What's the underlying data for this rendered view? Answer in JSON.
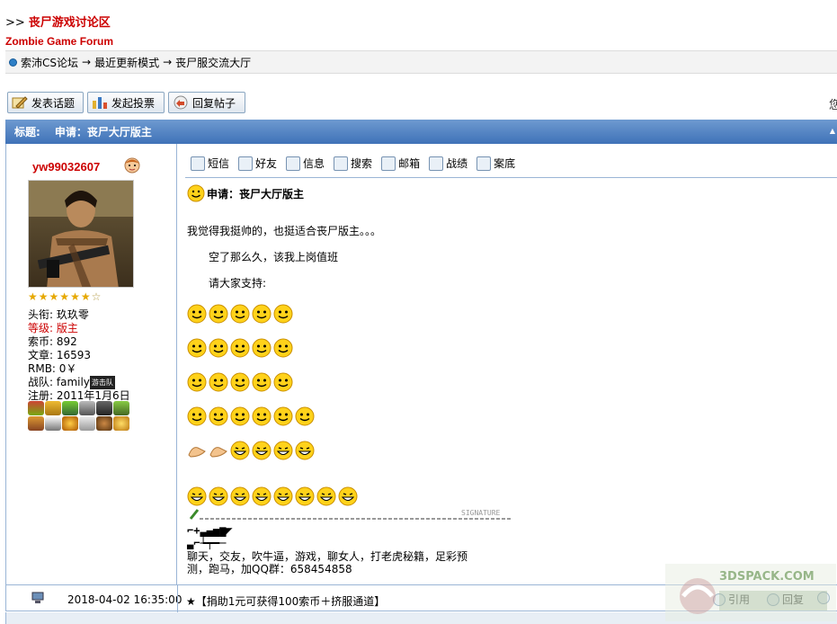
{
  "forum": {
    "arrows": ">>",
    "title_cn": "丧尸游戏讨论区",
    "title_en": "Zombie Game Forum"
  },
  "breadcrumb": {
    "items": [
      "索沛CS论坛",
      "最近更新模式",
      "丧尸服交流大厅"
    ],
    "separator": "→"
  },
  "toolbar": {
    "new_topic": "发表话题",
    "new_poll": "发起投票",
    "reply": "回复帖子",
    "edge_char": "您"
  },
  "topic": {
    "label": "标题:",
    "title": "申请：丧尸大厅版主"
  },
  "user": {
    "name": "yw99032607",
    "stars_filled": 6,
    "stars_total": 7,
    "rank_label": "头衔:",
    "rank": "玖玖零",
    "level_label": "等级:",
    "level": "版主",
    "coins_label": "索币:",
    "coins": "892",
    "posts_label": "文章:",
    "posts": "16593",
    "rmb_label": "RMB:",
    "rmb": "0￥",
    "team_label": "战队:",
    "team": "family",
    "team_badge": "游击队",
    "reg_label": "注册:",
    "reg": "2011年1月6日"
  },
  "actions": [
    "短信",
    "好友",
    "信息",
    "搜索",
    "邮箱",
    "战绩",
    "案底"
  ],
  "post": {
    "title": "申请：丧尸大厅版主",
    "line1": "我觉得我挺帅的，也挺适合丧尸版主。。。",
    "line2": "空了那么久，该我上岗值班",
    "line3": "请大家支持:",
    "signature_label": "SIGNATURE",
    "sig_art1": "⌐+▃▄▅▆◤",
    "sig_art2": "▃⌐┶┯━─",
    "sig_text": "聊天，交友，吹牛逼，游戏，聊女人，打老虎秘籍，足彩预测，跑马，加QQ群：658454858"
  },
  "footer": {
    "date": "2018-04-02 16:35:00",
    "notice": "★【捐助1元可获得100索币＋挤服通道】",
    "quote": "引用",
    "reply": "回复"
  },
  "watermark": {
    "text": "3DSPACK.COM"
  },
  "colors": {
    "accent_red": "#cc0000",
    "header_blue": "#4a7bbf",
    "border_blue": "#9ab5d6"
  }
}
